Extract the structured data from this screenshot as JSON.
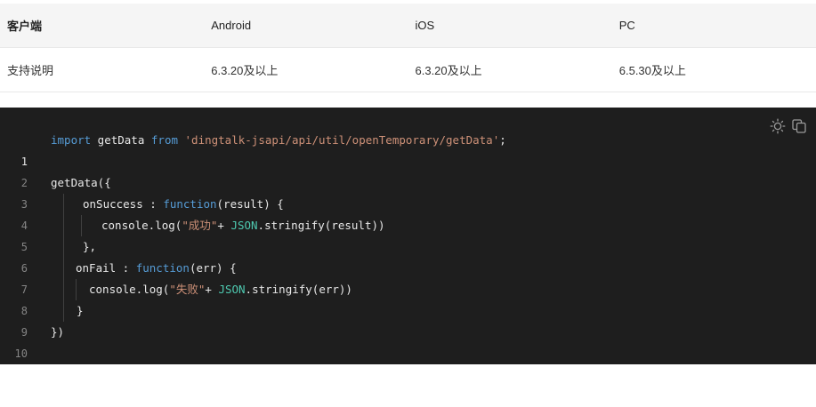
{
  "table": {
    "headers": [
      "客户端",
      "Android",
      "iOS",
      "PC"
    ],
    "rows": [
      [
        "支持说明",
        "6.3.20及以上",
        "6.3.20及以上",
        "6.5.30及以上"
      ]
    ]
  },
  "code": {
    "icons": [
      "sun-icon",
      "copy-icon"
    ],
    "line_numbers": [
      "1",
      "2",
      "3",
      "4",
      "5",
      "6",
      "7",
      "8",
      "9",
      "10"
    ],
    "lines": {
      "l1_kw1": "import",
      "l1_id": " getData ",
      "l1_kw2": "from",
      "l1_sp": " ",
      "l1_str": "'dingtalk-jsapi/api/util/openTemporary/getData'",
      "l1_end": ";",
      "l3": "getData({",
      "l4_a": "onSuccess : ",
      "l4_fn": "function",
      "l4_b": "(result) {",
      "l5_a": "console.log(",
      "l5_str": "\"成功\"",
      "l5_b": "+ ",
      "l5_cls": "JSON",
      "l5_c": ".stringify(result))",
      "l6": "},",
      "l7_a": "onFail : ",
      "l7_fn": "function",
      "l7_b": "(err) {",
      "l8_a": "console.log(",
      "l8_str": "\"失败\"",
      "l8_b": "+ ",
      "l8_cls": "JSON",
      "l8_c": ".stringify(err))",
      "l9": "}",
      "l10": "})"
    }
  }
}
